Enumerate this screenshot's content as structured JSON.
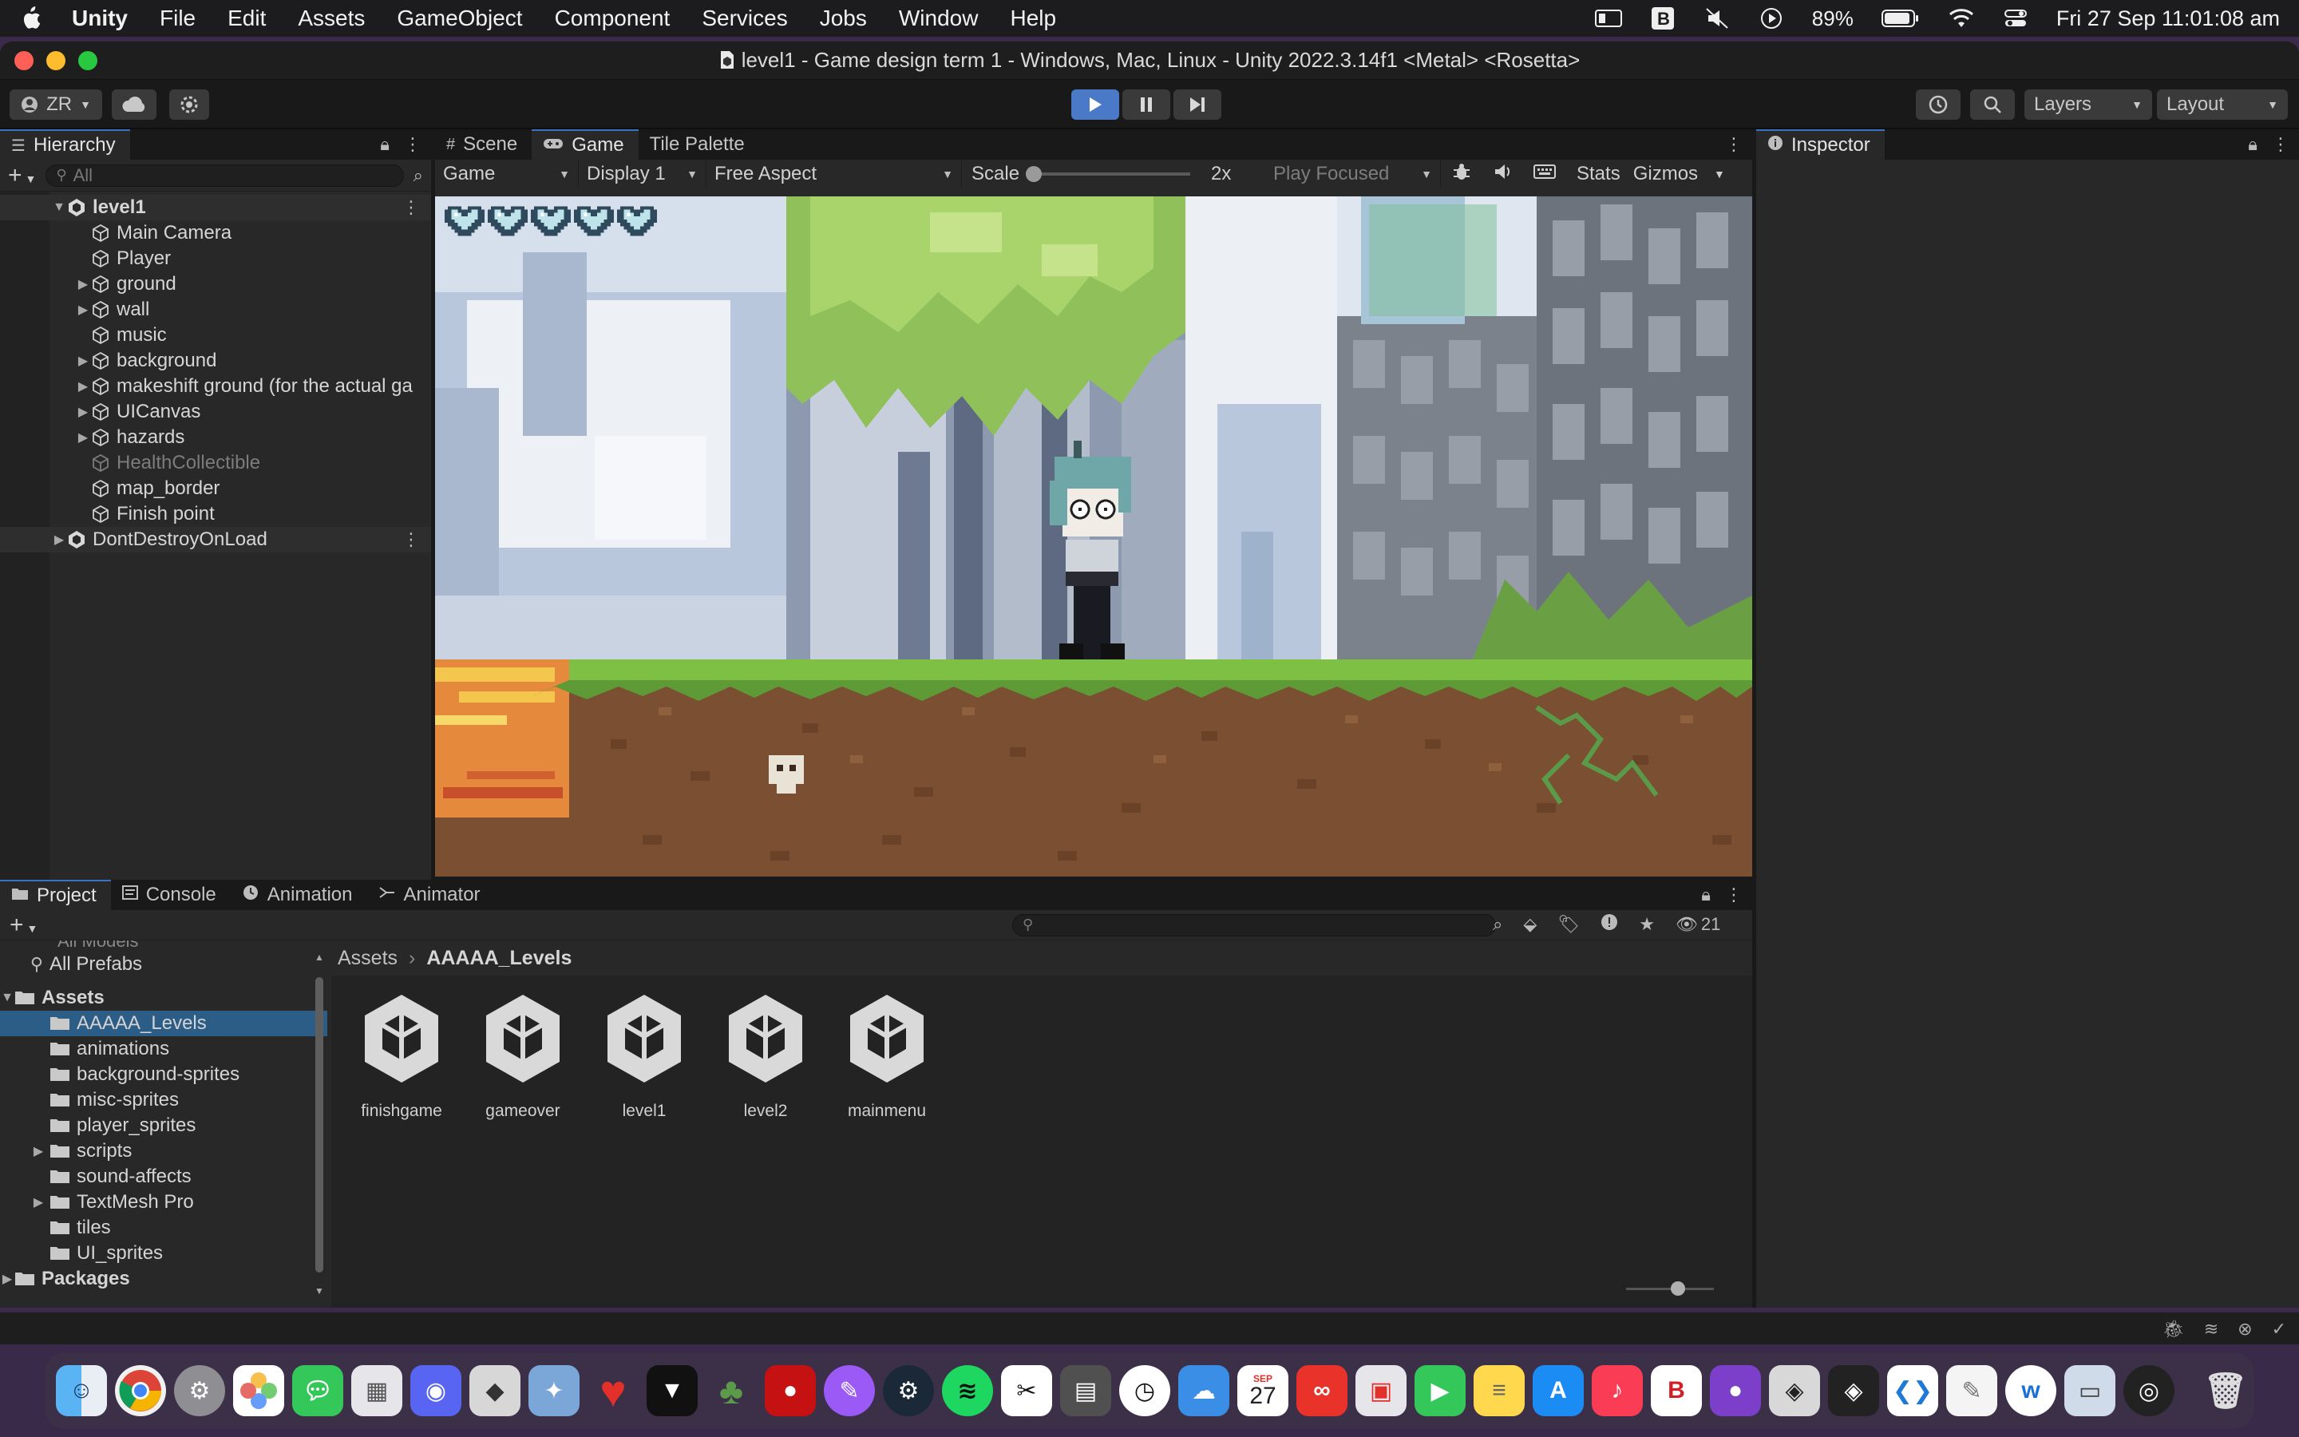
{
  "menubar": {
    "app_name": "Unity",
    "items": [
      "File",
      "Edit",
      "Assets",
      "GameObject",
      "Component",
      "Services",
      "Jobs",
      "Window",
      "Help"
    ],
    "battery": "89%",
    "datetime": "Fri 27 Sep  11:01:08 am"
  },
  "window": {
    "title": "level1 - Game design term 1 - Windows, Mac, Linux - Unity 2022.3.14f1 <Metal> <Rosetta>"
  },
  "toolbar": {
    "account": "ZR",
    "layers": "Layers",
    "layout": "Layout"
  },
  "hierarchy": {
    "tab": "Hierarchy",
    "search_placeholder": "All",
    "scene": "level1",
    "objects": [
      {
        "label": "Main Camera",
        "expandable": false,
        "disabled": false
      },
      {
        "label": "Player",
        "expandable": false,
        "disabled": false
      },
      {
        "label": "ground",
        "expandable": true,
        "disabled": false
      },
      {
        "label": "wall",
        "expandable": true,
        "disabled": false
      },
      {
        "label": "music",
        "expandable": false,
        "disabled": false
      },
      {
        "label": "background",
        "expandable": true,
        "disabled": false
      },
      {
        "label": "makeshift ground (for the actual ga",
        "expandable": true,
        "disabled": false
      },
      {
        "label": "UICanvas",
        "expandable": true,
        "disabled": false
      },
      {
        "label": "hazards",
        "expandable": true,
        "disabled": false
      },
      {
        "label": "HealthCollectible",
        "expandable": false,
        "disabled": true
      },
      {
        "label": "map_border",
        "expandable": false,
        "disabled": false
      },
      {
        "label": "Finish point",
        "expandable": false,
        "disabled": false
      }
    ],
    "dont_destroy": "DontDestroyOnLoad"
  },
  "game_view": {
    "tabs": [
      "Scene",
      "Game",
      "Tile Palette"
    ],
    "active_tab": "Game",
    "mode": "Game",
    "display": "Display 1",
    "aspect": "Free Aspect",
    "scale_label": "Scale",
    "scale_value": "2x",
    "play_focused": "Play Focused",
    "stats": "Stats",
    "gizmos": "Gizmos",
    "hearts": 5
  },
  "inspector": {
    "tab": "Inspector"
  },
  "project": {
    "tabs": [
      "Project",
      "Console",
      "Animation",
      "Animator"
    ],
    "hidden_count": "21",
    "partial_item": "All Models",
    "all_prefabs": "All Prefabs",
    "assets_root": "Assets",
    "folders": [
      {
        "label": "AAAAA_Levels",
        "expandable": false,
        "selected": true
      },
      {
        "label": "animations",
        "expandable": false,
        "selected": false
      },
      {
        "label": "background-sprites",
        "expandable": false,
        "selected": false
      },
      {
        "label": "misc-sprites",
        "expandable": false,
        "selected": false
      },
      {
        "label": "player_sprites",
        "expandable": false,
        "selected": false
      },
      {
        "label": "scripts",
        "expandable": true,
        "selected": false
      },
      {
        "label": "sound-affects",
        "expandable": false,
        "selected": false
      },
      {
        "label": "TextMesh Pro",
        "expandable": true,
        "selected": false
      },
      {
        "label": "tiles",
        "expandable": false,
        "selected": false
      },
      {
        "label": "UI_sprites",
        "expandable": false,
        "selected": false
      }
    ],
    "packages": "Packages",
    "breadcrumb": [
      "Assets",
      "AAAAA_Levels"
    ],
    "assets": [
      "finishgame",
      "gameover",
      "level1",
      "level2",
      "mainmenu"
    ]
  },
  "dock": {
    "calendar_month": "SEP",
    "calendar_day": "27"
  }
}
